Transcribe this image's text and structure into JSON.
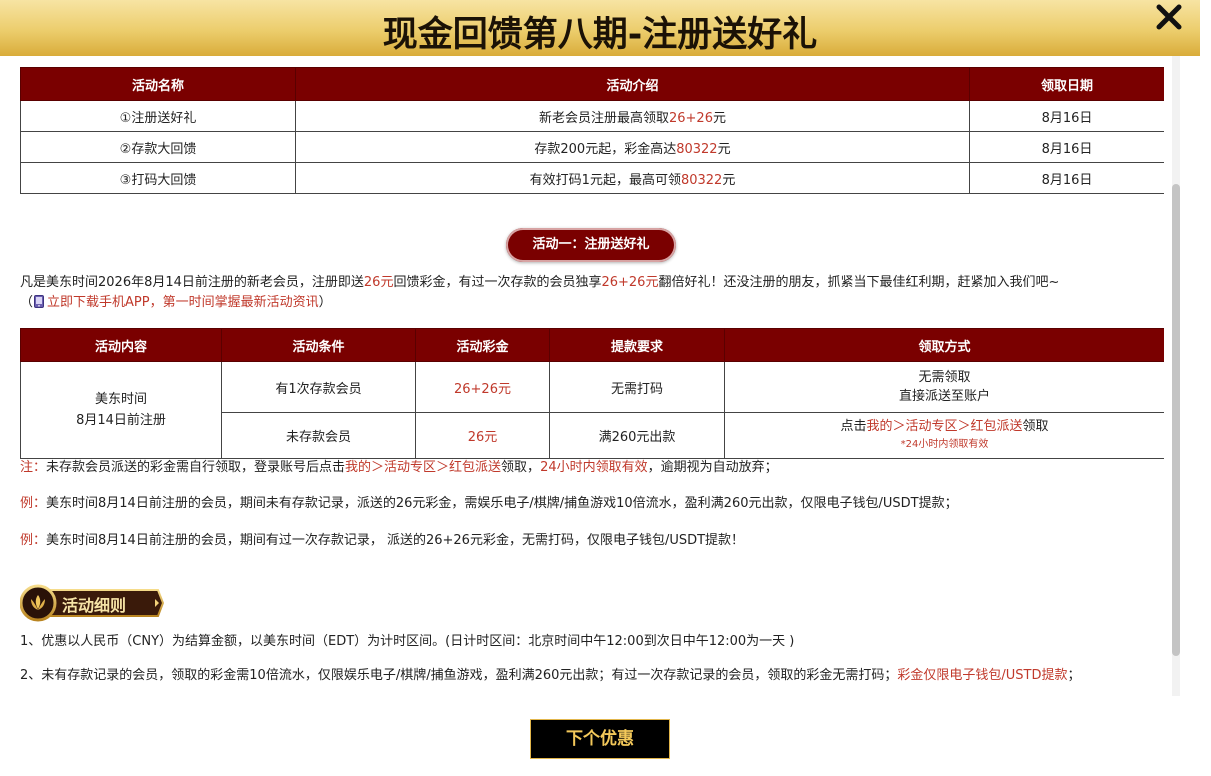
{
  "header": {
    "title": "现金回馈第八期-注册送好礼",
    "close_icon": "close-icon"
  },
  "summary_table": {
    "headers": [
      "活动名称",
      "活动介绍",
      "领取日期"
    ],
    "rows": [
      {
        "name": "①注册送好礼",
        "intro_pre": "新老会员注册最高领取",
        "intro_hl": "26+26",
        "intro_post": "元",
        "date": "8月16日"
      },
      {
        "name": "②存款大回馈",
        "intro_pre": "存款200元起，彩金高达",
        "intro_hl": "80322",
        "intro_post": "元",
        "date": "8月16日"
      },
      {
        "name": "③打码大回馈",
        "intro_pre": "有效打码1元起，最高可领",
        "intro_hl": "80322",
        "intro_post": "元",
        "date": "8月16日"
      }
    ]
  },
  "section1": {
    "pill": "活动一：注册送好礼"
  },
  "intro": {
    "p1": "凡是美东时间2026年8月14日前注册的新老会员，注册即送",
    "p2": "26元",
    "p3": "回馈彩金，有过一次存款的会员独享",
    "p4": "26+26元",
    "p5": "翻倍好礼！还没注册的朋友，抓紧当下最佳红利期，赶紧加入我们吧~",
    "app_open": "（",
    "app_link": "立即下载手机APP，第一时间掌握最新活动资讯",
    "app_close": "）",
    "phone_icon": "phone-icon"
  },
  "detail_table": {
    "headers": [
      "活动内容",
      "活动条件",
      "活动彩金",
      "提款要求",
      "领取方式"
    ],
    "content_line1": "美东时间",
    "content_line2": "8月14日前注册",
    "row1": {
      "condition": "有1次存款会员",
      "bonus": "26+26元",
      "withdraw": "无需打码",
      "claim_line1": "无需领取",
      "claim_line2": "直接派送至账户"
    },
    "row2": {
      "condition": "未存款会员",
      "bonus": "26元",
      "withdraw": "满260元出款",
      "claim_pre": "点击",
      "claim_link": "我的＞活动专区＞红包派送",
      "claim_post": "领取",
      "claim_note": "*24小时内领取有效"
    }
  },
  "notes": {
    "n1_label": "注：",
    "n1_pre": "未存款会员派送的彩金需自行领取，登录账号后点击",
    "n1_link": "我的＞活动专区＞红包派送",
    "n1_mid": "领取，",
    "n1_hl": "24小时内领取有效",
    "n1_post": "，逾期视为自动放弃；",
    "n2_label": "例：",
    "n2_text": "美东时间8月14日前注册的会员，期间未有存款记录，派送的26元彩金，需娱乐电子/棋牌/捕鱼游戏10倍流水，盈利满260元出款，仅限电子钱包/USDT提款；",
    "n3_label": "例：",
    "n3_text": "美东时间8月14日前注册的会员，期间有过一次存款记录， 派送的26+26元彩金，无需打码，仅限电子钱包/USDT提款！"
  },
  "rules_badge": {
    "label": "活动细则",
    "icon": "laurel-icon"
  },
  "rules": {
    "r1": "1、优惠以人民币（CNY）为结算金额，以美东时间（EDT）为计时区间。(日计时区间：北京时间中午12:00到次日中午12:00为一天 )",
    "r2_pre": "2、未有存款记录的会员，领取的彩金需10倍流水，仅限娱乐电子/棋牌/捕鱼游戏，盈利满260元出款；有过一次存款记录的会员，领取的彩金无需打码；",
    "r2_hl": "彩金仅限电子钱包/USTD提款",
    "r2_end": "；"
  },
  "footer": {
    "next_button": "下个优惠"
  },
  "colors": {
    "header_gold": "#eccd6c",
    "table_header": "#7a0000",
    "highlight": "#c0392b",
    "button_text": "#f3c85a"
  }
}
